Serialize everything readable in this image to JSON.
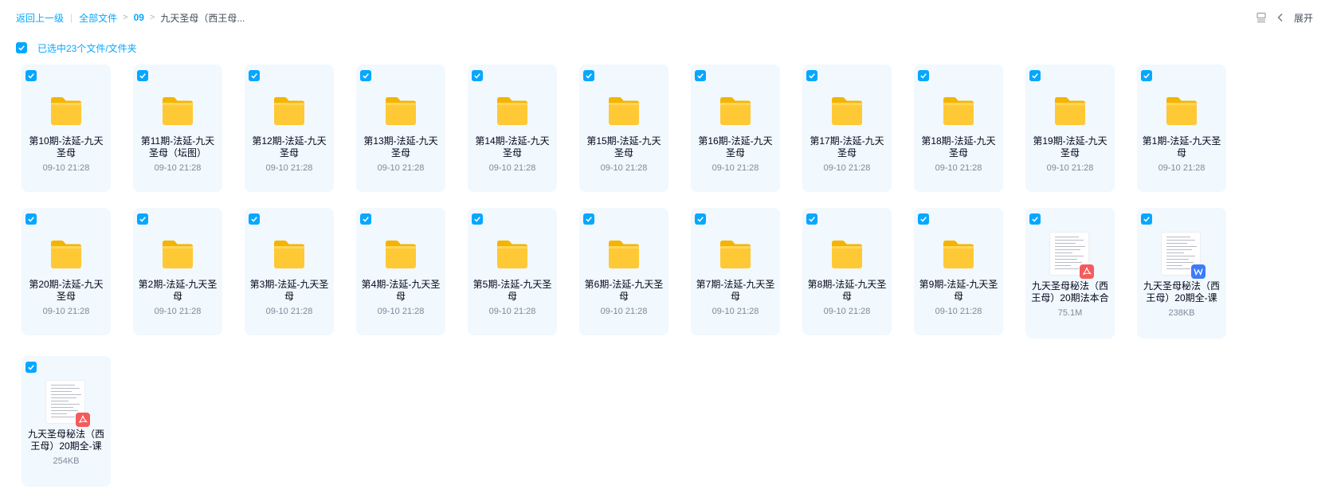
{
  "breadcrumb": {
    "back": "返回上一级",
    "all_files": "全部文件",
    "level1": "09",
    "current": "九天圣母（西王母..."
  },
  "toolbar": {
    "expand_label": "展开",
    "icons": [
      "tree-view-icon",
      "chevron-left-icon"
    ]
  },
  "selection": {
    "label": "已选中23个文件/文件夹"
  },
  "colors": {
    "accent": "#06a7ff",
    "card_bg": "#f1f8fe",
    "folder": "#ffc935",
    "pdf_badge": "#f45c5c",
    "word_badge": "#3e7bfa"
  },
  "files": [
    {
      "type": "folder",
      "name": "第10期-法延-九天圣母",
      "meta": "09-10 21:28"
    },
    {
      "type": "folder",
      "name": "第11期-法延-九天圣母（坛图）",
      "meta": "09-10 21:28"
    },
    {
      "type": "folder",
      "name": "第12期-法延-九天圣母",
      "meta": "09-10 21:28"
    },
    {
      "type": "folder",
      "name": "第13期-法延-九天圣母",
      "meta": "09-10 21:28"
    },
    {
      "type": "folder",
      "name": "第14期-法延-九天圣母",
      "meta": "09-10 21:28"
    },
    {
      "type": "folder",
      "name": "第15期-法延-九天圣母",
      "meta": "09-10 21:28"
    },
    {
      "type": "folder",
      "name": "第16期-法延-九天圣母",
      "meta": "09-10 21:28"
    },
    {
      "type": "folder",
      "name": "第17期-法延-九天圣母",
      "meta": "09-10 21:28"
    },
    {
      "type": "folder",
      "name": "第18期-法延-九天圣母",
      "meta": "09-10 21:28"
    },
    {
      "type": "folder",
      "name": "第19期-法延-九天圣母",
      "meta": "09-10 21:28"
    },
    {
      "type": "folder",
      "name": "第1期-法延-九天圣母",
      "meta": "09-10 21:28"
    },
    {
      "type": "folder",
      "name": "第20期-法延-九天圣母",
      "meta": "09-10 21:28"
    },
    {
      "type": "folder",
      "name": "第2期-法延-九天圣母",
      "meta": "09-10 21:28"
    },
    {
      "type": "folder",
      "name": "第3期-法延-九天圣母",
      "meta": "09-10 21:28"
    },
    {
      "type": "folder",
      "name": "第4期-法延-九天圣母",
      "meta": "09-10 21:28"
    },
    {
      "type": "folder",
      "name": "第5期-法延-九天圣母",
      "meta": "09-10 21:28"
    },
    {
      "type": "folder",
      "name": "第6期-法延-九天圣母",
      "meta": "09-10 21:28"
    },
    {
      "type": "folder",
      "name": "第7期-法延-九天圣母",
      "meta": "09-10 21:28"
    },
    {
      "type": "folder",
      "name": "第8期-法延-九天圣母",
      "meta": "09-10 21:28"
    },
    {
      "type": "folder",
      "name": "第9期-法延-九天圣母",
      "meta": "09-10 21:28"
    },
    {
      "type": "pdf",
      "name": "九天圣母秘法（西王母）20期法本合",
      "meta": "75.1M"
    },
    {
      "type": "word",
      "name": "九天圣母秘法（西王母）20期全-课",
      "meta": "238KB"
    },
    {
      "type": "pdf",
      "name": "九天圣母秘法（西王母）20期全-课",
      "meta": "254KB"
    }
  ]
}
